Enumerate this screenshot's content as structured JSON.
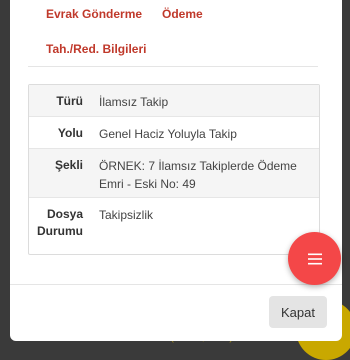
{
  "tabs": {
    "evrak_gonderme": "Evrak Gönderme",
    "odeme": "Ödeme",
    "tah_red": "Tah./Red. Bilgileri"
  },
  "details": {
    "rows": [
      {
        "label": "Türü",
        "value": "İlamsız Takip"
      },
      {
        "label": "Yolu",
        "value": "Genel Haciz Yoluyla Takip"
      },
      {
        "label": "Şekli",
        "value": "ÖRNEK: 7 İlamsız Takiplerde Ödeme Emri - Eski No: 49"
      },
      {
        "label": "Dosya Durumu",
        "value": "Takipsizlik"
      }
    ]
  },
  "footer": {
    "close_label": "Kapat"
  },
  "fab": {
    "icon": "menu-icon"
  },
  "colors": {
    "accent": "#c0392b",
    "fab": "#f44748"
  }
}
